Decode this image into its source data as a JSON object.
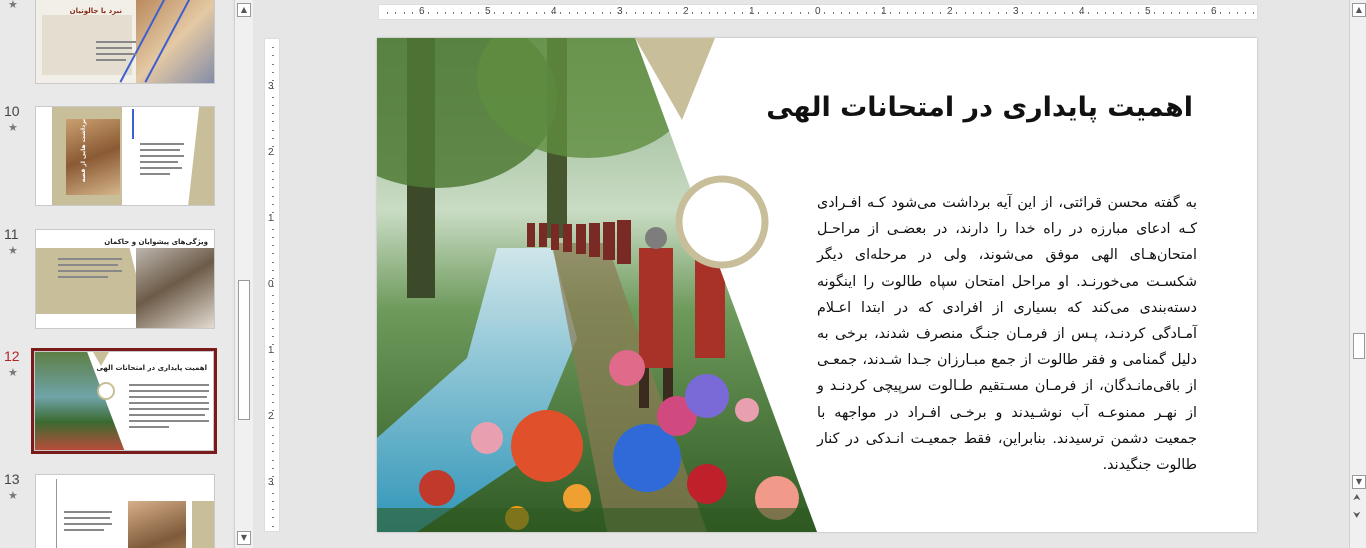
{
  "thumbnails": [
    {
      "number": "",
      "title": "نبرد با جالوتیان"
    },
    {
      "number": "10",
      "title": "برداشت هایی از قصه"
    },
    {
      "number": "11",
      "title": "ویژگی‌های پیشوایان و حاکمان"
    },
    {
      "number": "12",
      "title": "اهمیت پایداری در امتحانات الهی",
      "active": true
    },
    {
      "number": "13",
      "title": ""
    }
  ],
  "star": "★",
  "ruler": {
    "h_labels": [
      "6",
      "5",
      "4",
      "3",
      "2",
      "1",
      "0",
      "1",
      "2",
      "3",
      "4",
      "5",
      "6"
    ],
    "v_labels": [
      "3",
      "2",
      "1",
      "0",
      "1",
      "2",
      "3"
    ]
  },
  "scroll": {
    "up": "▲",
    "down": "▼",
    "prev_slide": "⮝",
    "next_slide": "⮟"
  },
  "slide": {
    "title": "اهمیت پایداری در امتحانات الهی",
    "body": "به گفته محسن قرائتی، از این آیه برداشت می‌شود کـه افـرادی کـه ادعای مبارزه در راه خدا را دارند، در بعضـی از مراحـل امتحان‌هـای الهی موفق می‌شوند، ولی در مرحله‌ای دیگر شکسـت می‌خورنـد. او مراحل امتحان سپاه طالوت را اینگونه دسته‌بندی می‌کند که بسیاری از افرادی که در ابتدا اعـلام آمـادگی کردنـد، پـس از فرمـان جنـگ منصرف شدند، برخی به دلیل گمنامی و فقر طالوت از جمع مبـارزان جـدا شـدند، جمعـی از باقی‌مانـدگان، از فرمـان مسـتقیم طـالوت سرپیچی کردنـد و از نهـر ممنوعـه آب نوشـیدند و برخـی افـراد در مواجهه با جمعیت دشمن ترسیدند. بنابراین، فقط جمعیـت انـدکی در کنار طالوت جنگیدند."
  },
  "colors": {
    "accent": "#c8bf9a",
    "active_thumb_border": "#7a1b1b",
    "active_number": "#b02525"
  },
  "icons": [
    "star-icon",
    "scroll-up-icon",
    "scroll-down-icon",
    "previous-slide-icon",
    "next-slide-icon"
  ]
}
